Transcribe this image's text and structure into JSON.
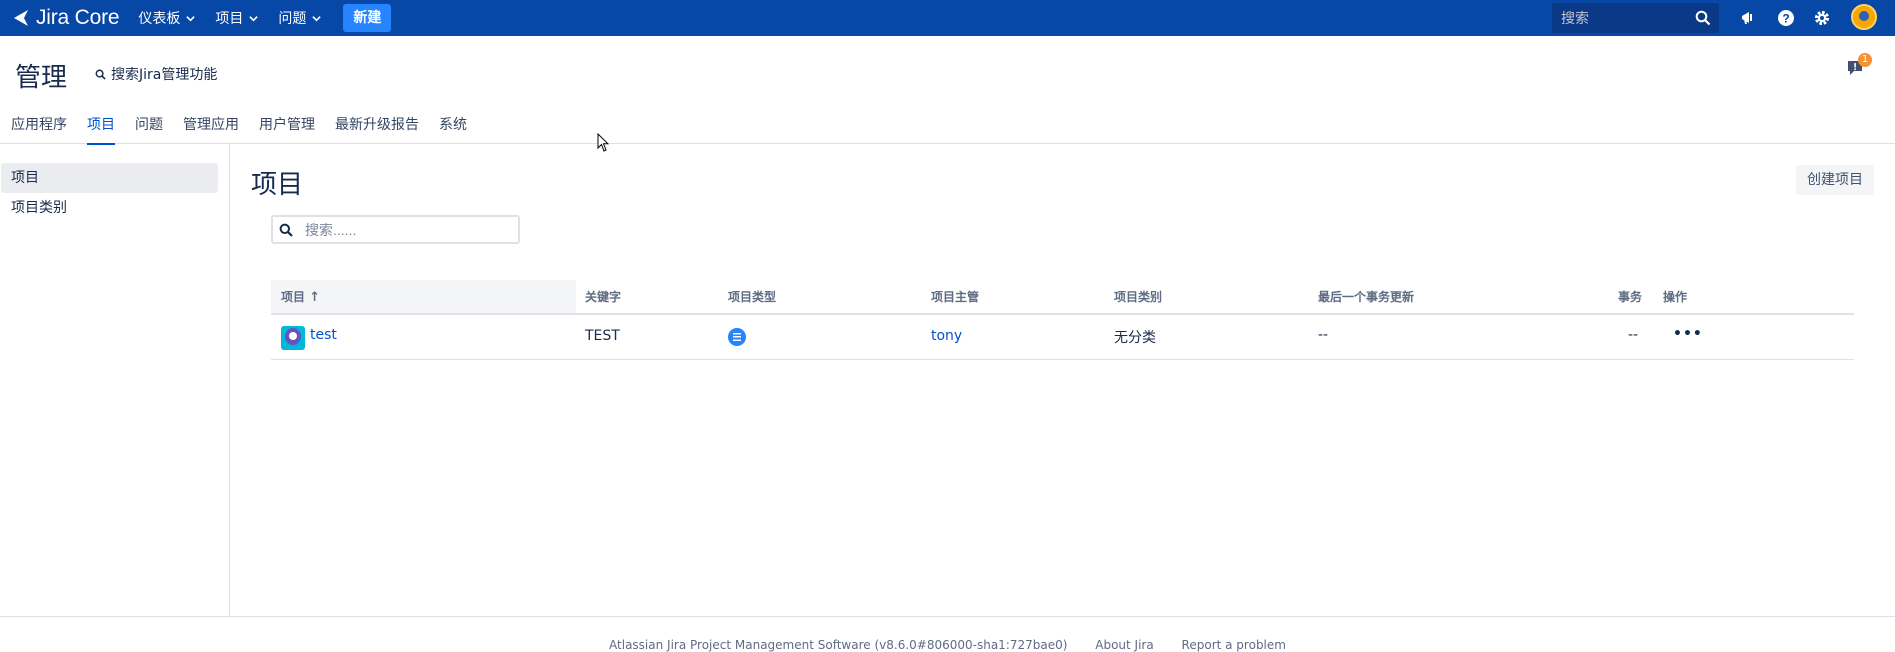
{
  "topnav": {
    "logo": "Jira Core",
    "menus": [
      "仪表板",
      "项目",
      "问题"
    ],
    "create_label": "新建",
    "search_placeholder": "搜索"
  },
  "admin": {
    "title": "管理",
    "search_label": "搜索Jira管理功能",
    "feedback_badge": "1",
    "tabs": [
      "应用程序",
      "项目",
      "问题",
      "管理应用",
      "用户管理",
      "最新升级报告",
      "系统"
    ],
    "active_tab": "项目"
  },
  "sidebar": {
    "items": [
      "项目",
      "项目类别"
    ]
  },
  "main": {
    "title": "项目",
    "create_button": "创建项目",
    "filter_placeholder": "搜索......"
  },
  "table": {
    "headers": [
      "项目",
      "关键字",
      "项目类型",
      "项目主管",
      "项目类别",
      "最后一个事务更新",
      "事务",
      "操作"
    ],
    "sort_arrow": "↑",
    "rows": [
      {
        "name": "test",
        "key": "TEST",
        "type_icon": "business-project-icon",
        "lead": "tony",
        "category": "无分类",
        "last_update": "--",
        "issues": "--",
        "actions": "•••"
      }
    ]
  },
  "footer": {
    "version": "Atlassian Jira Project Management Software (v8.6.0#806000-sha1:727bae0)",
    "about": "About Jira",
    "report": "Report a problem"
  },
  "colors": {
    "topnav_bg": "#0747a6",
    "create_btn": "#2684ff",
    "link": "#0052cc"
  }
}
